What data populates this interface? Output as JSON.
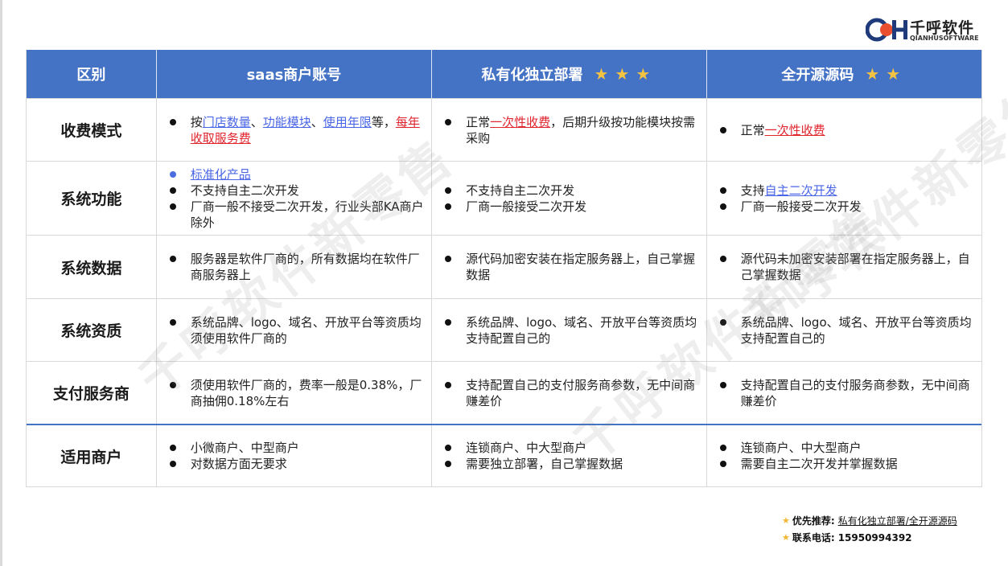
{
  "logo": {
    "name_cn": "千呼软件",
    "name_en": "QIANHUSOFTWARE"
  },
  "header": {
    "col0": "区别",
    "col1": "saas商户账号",
    "col2": "私有化独立部署",
    "col2_stars": "★★★",
    "col3": "全开源源码",
    "col3_stars": "★★"
  },
  "rows": [
    {
      "label": "收费模式",
      "c1": [
        {
          "segments": [
            {
              "t": "按",
              "s": "n"
            },
            {
              "t": "门店数量",
              "s": "blue"
            },
            {
              "t": "、",
              "s": "n"
            },
            {
              "t": "功能模块",
              "s": "blue"
            },
            {
              "t": "、",
              "s": "n"
            },
            {
              "t": "使用年限",
              "s": "blue"
            },
            {
              "t": "等，",
              "s": "n"
            },
            {
              "t": "每年收取服务费",
              "s": "red"
            }
          ]
        }
      ],
      "c2": [
        {
          "segments": [
            {
              "t": "正常",
              "s": "n"
            },
            {
              "t": "一次性收费",
              "s": "red"
            },
            {
              "t": "，后期升级按功能模块按需采购",
              "s": "n"
            }
          ]
        }
      ],
      "c3": [
        {
          "segments": [
            {
              "t": "正常",
              "s": "n"
            },
            {
              "t": "一次性收费",
              "s": "red"
            }
          ]
        }
      ]
    },
    {
      "label": "系统功能",
      "c1": [
        {
          "dot": "blue",
          "segments": [
            {
              "t": "标准化产品",
              "s": "blue"
            }
          ]
        },
        {
          "segments": [
            {
              "t": "不支持自主二次开发",
              "s": "n"
            }
          ]
        },
        {
          "segments": [
            {
              "t": "厂商一般不接受二次开发，行业头部KA商户除外",
              "s": "n"
            }
          ]
        }
      ],
      "c2": [
        {
          "segments": [
            {
              "t": "不支持自主二次开发",
              "s": "n"
            }
          ]
        },
        {
          "segments": [
            {
              "t": "厂商一般接受二次开发",
              "s": "n"
            }
          ]
        }
      ],
      "c3": [
        {
          "segments": [
            {
              "t": "支持",
              "s": "n"
            },
            {
              "t": "自主二次开发",
              "s": "blue"
            }
          ]
        },
        {
          "segments": [
            {
              "t": "厂商一般接受二次开发",
              "s": "n"
            }
          ]
        }
      ]
    },
    {
      "label": "系统数据",
      "c1": [
        {
          "segments": [
            {
              "t": "服务器是软件厂商的，所有数据均在软件厂商服务器上",
              "s": "n"
            }
          ]
        }
      ],
      "c2": [
        {
          "segments": [
            {
              "t": "源代码加密安装在指定服务器上，自己掌握数据",
              "s": "n"
            }
          ]
        }
      ],
      "c3": [
        {
          "segments": [
            {
              "t": "源代码未加密安装部署在指定服务器上，自己掌握数据",
              "s": "n"
            }
          ]
        }
      ]
    },
    {
      "label": "系统资质",
      "c1": [
        {
          "segments": [
            {
              "t": "系统品牌、logo、域名、开放平台等资质均须使用软件厂商的",
              "s": "n"
            }
          ]
        }
      ],
      "c2": [
        {
          "segments": [
            {
              "t": "系统品牌、logo、域名、开放平台等资质均支持配置自己的",
              "s": "n"
            }
          ]
        }
      ],
      "c3": [
        {
          "segments": [
            {
              "t": "系统品牌、logo、域名、开放平台等资质均支持配置自己的",
              "s": "n"
            }
          ]
        }
      ]
    },
    {
      "label": "支付服务商",
      "c1": [
        {
          "segments": [
            {
              "t": "须使用软件厂商的，费率一般是0.38%，厂商抽佣0.18%左右",
              "s": "n"
            }
          ]
        }
      ],
      "c2": [
        {
          "segments": [
            {
              "t": "支持配置自己的支付服务商参数，无中间商赚差价",
              "s": "n"
            }
          ]
        }
      ],
      "c3": [
        {
          "segments": [
            {
              "t": "支持配置自己的支付服务商参数，无中间商赚差价",
              "s": "n"
            }
          ]
        }
      ]
    },
    {
      "label": "适用商户",
      "c1": [
        {
          "segments": [
            {
              "t": "小微商户、中型商户",
              "s": "n"
            }
          ]
        },
        {
          "segments": [
            {
              "t": "对数据方面无要求",
              "s": "n"
            }
          ]
        }
      ],
      "c2": [
        {
          "segments": [
            {
              "t": "连锁商户、中大型商户",
              "s": "n"
            }
          ]
        },
        {
          "segments": [
            {
              "t": "需要独立部署，自己掌握数据",
              "s": "n"
            }
          ]
        }
      ],
      "c3": [
        {
          "segments": [
            {
              "t": "连锁商户、中大型商户",
              "s": "n"
            }
          ]
        },
        {
          "segments": [
            {
              "t": "需要自主二次开发并掌握数据",
              "s": "n"
            }
          ]
        }
      ]
    }
  ],
  "watermark": [
    "千呼软件新零售",
    "千呼软件新零售",
    "千呼软件新零售"
  ],
  "footer": {
    "recommend_label": "优先推荐:",
    "recommend_value": "私有化独立部署/全开源源码",
    "phone_label": "联系电话:",
    "phone_value": "15950994392",
    "star": "★"
  },
  "colors": {
    "header_bg": "#4472c4",
    "link_blue": "#4a66e6",
    "emphasis_red": "#e0242e",
    "star_gold": "#f5c342"
  }
}
